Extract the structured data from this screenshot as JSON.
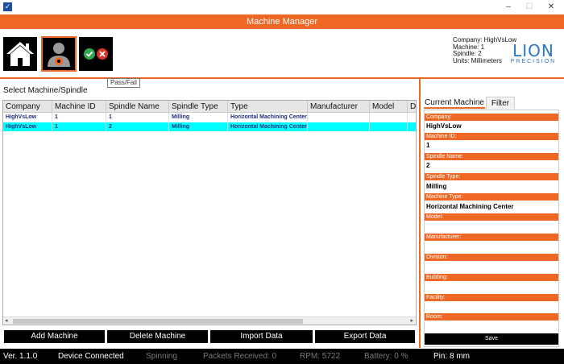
{
  "window": {
    "title": "Machine Manager",
    "min": "–",
    "max": "☐",
    "close": "✕",
    "app_icon": "check-icon"
  },
  "toolbar": {
    "home_icon": "home-icon",
    "operator_icon": "operator-icon",
    "passfail_icon": "pass-fail-icon",
    "tooltip": "Pass/Fail"
  },
  "machine_info": {
    "company": "Company: HighVsLow",
    "machine": "Machine: 1",
    "spindle": "Spindle: 2",
    "units": "Units: Millimeters"
  },
  "logo": {
    "main": "LION",
    "sub": "PRECISION"
  },
  "table": {
    "label": "Select Machine/Spindle",
    "columns": [
      "Company",
      "Machine ID",
      "Spindle Name",
      "Spindle Type",
      "Type",
      "Manufacturer",
      "Model",
      "Di"
    ],
    "rows": [
      [
        "HighVsLow",
        "1",
        "1",
        "Milling",
        "Horizontal Machining Center",
        "",
        "",
        ""
      ],
      [
        "HighVsLow",
        "1",
        "2",
        "Milling",
        "Horizontal Machining Center",
        "",
        "",
        ""
      ]
    ],
    "selected_row": 1,
    "scroll_left": "◂",
    "scroll_right": "▸"
  },
  "actions": {
    "add": "Add Machine",
    "delete": "Delete Machine",
    "import": "Import Data",
    "export": "Export Data"
  },
  "tabs": {
    "current": "Current Machine",
    "filter": "Filter"
  },
  "form": {
    "company_label": "Company:",
    "company_value": "HighVsLow",
    "machine_id_label": "Machine ID:",
    "machine_id_value": "1",
    "spindle_name_label": "Spindle Name:",
    "spindle_name_value": "2",
    "spindle_type_label": "Spindle Type:",
    "spindle_type_value": "Milling",
    "machine_type_label": "Machine Type:",
    "machine_type_value": "Horizontal Machining Center",
    "model_label": "Model:",
    "manufacturer_label": "Manufacturer:",
    "division_label": "Division:",
    "building_label": "Building:",
    "facility_label": "Facility:",
    "room_label": "Room:",
    "save": "Save"
  },
  "status": {
    "version": "Ver. 1.1.0",
    "device": "Device Connected",
    "spinning": "Spinning",
    "packets": "Packets Received:  0",
    "rpm": "RPM:  5722",
    "battery": "Battery:  0  %",
    "pin": "Pin: 8 mm"
  },
  "colors": {
    "accent": "#ef6724",
    "selected_row": "#00ffff",
    "pass": "#2fa84f",
    "fail": "#d9342b",
    "logo": "#2a78c2"
  }
}
